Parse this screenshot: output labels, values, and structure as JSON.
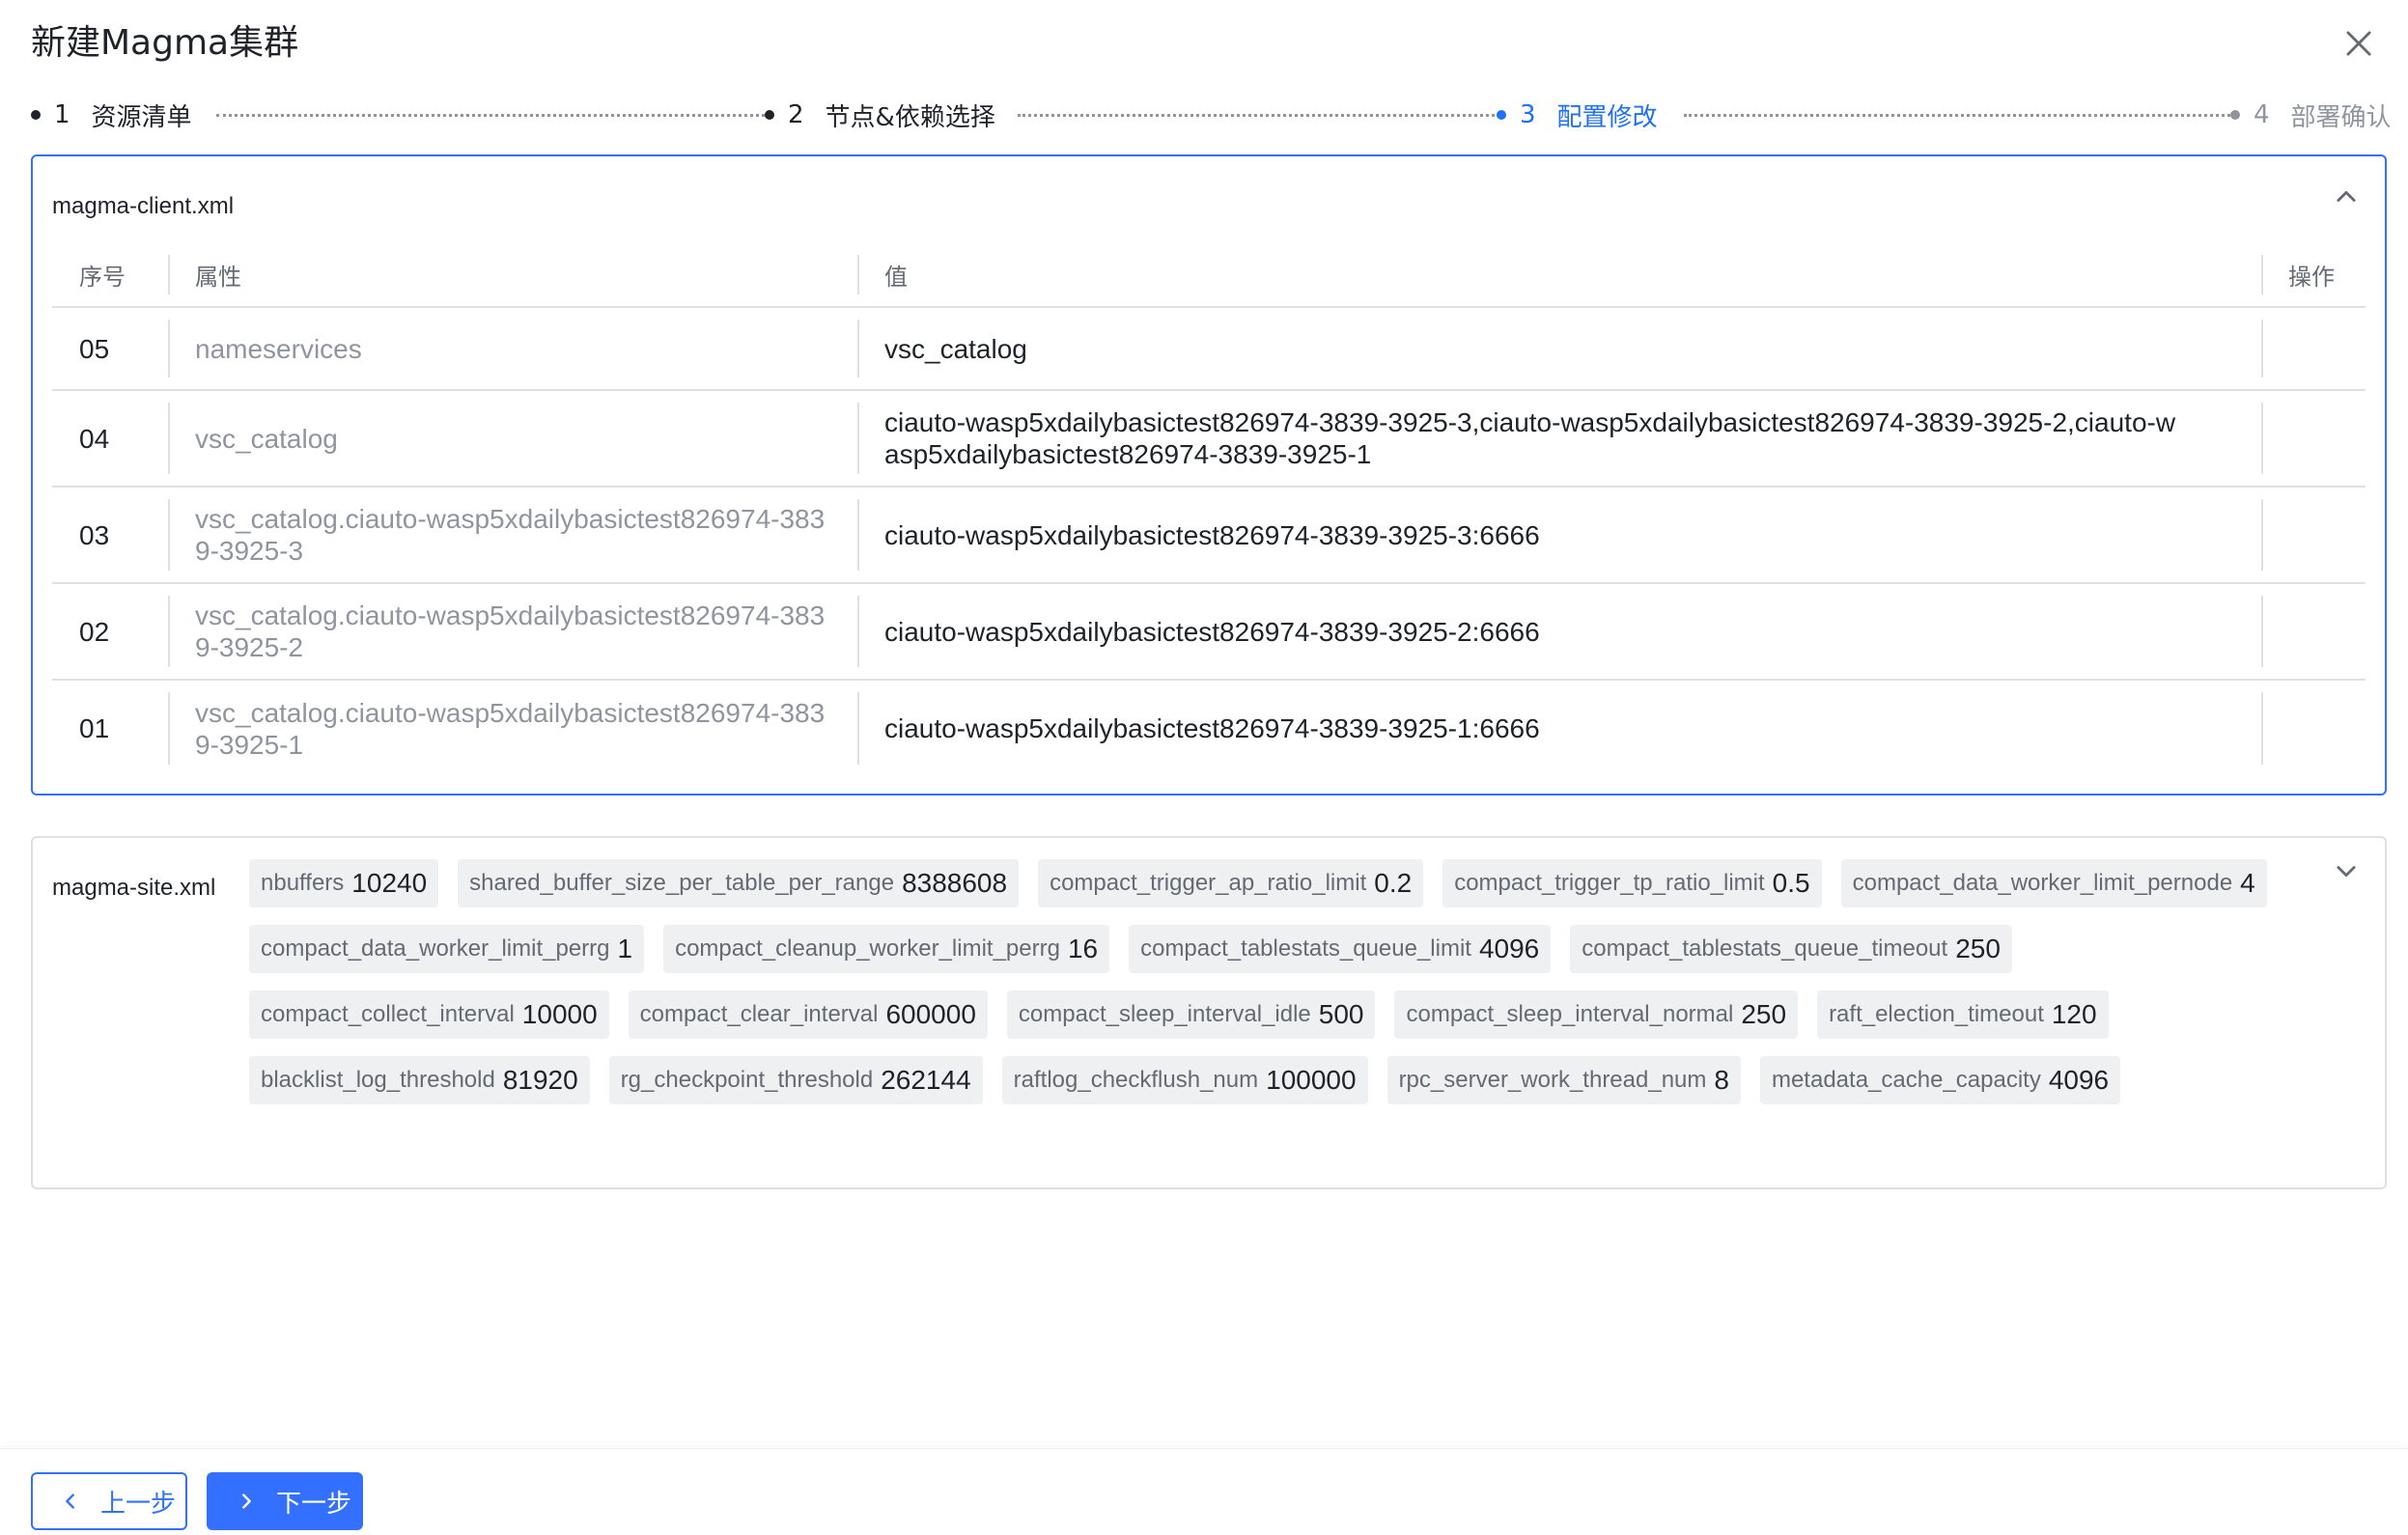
{
  "dialog": {
    "title": "新建Magma集群"
  },
  "steps": [
    {
      "num": "1",
      "label": "资源清单",
      "state": "done"
    },
    {
      "num": "2",
      "label": "节点&依赖选择",
      "state": "done"
    },
    {
      "num": "3",
      "label": "配置修改",
      "state": "active"
    },
    {
      "num": "4",
      "label": "部署确认",
      "state": "future"
    }
  ],
  "client_panel": {
    "title": "magma-client.xml",
    "columns": {
      "seq": "序号",
      "attr": "属性",
      "val": "值",
      "op": "操作"
    },
    "rows": [
      {
        "seq": "05",
        "attr": "nameservices",
        "val": "vsc_catalog"
      },
      {
        "seq": "04",
        "attr": "vsc_catalog",
        "val": "ciauto-wasp5xdailybasictest826974-3839-3925-3,ciauto-wasp5xdailybasictest826974-3839-3925-2,ciauto-wasp5xdailybasictest826974-3839-3925-1"
      },
      {
        "seq": "03",
        "attr": "vsc_catalog.ciauto-wasp5xdailybasictest826974-3839-3925-3",
        "val": "ciauto-wasp5xdailybasictest826974-3839-3925-3:6666"
      },
      {
        "seq": "02",
        "attr": "vsc_catalog.ciauto-wasp5xdailybasictest826974-3839-3925-2",
        "val": "ciauto-wasp5xdailybasictest826974-3839-3925-2:6666"
      },
      {
        "seq": "01",
        "attr": "vsc_catalog.ciauto-wasp5xdailybasictest826974-3839-3925-1",
        "val": "ciauto-wasp5xdailybasictest826974-3839-3925-1:6666"
      }
    ]
  },
  "site_panel": {
    "title": "magma-site.xml",
    "tags": [
      {
        "key": "nbuffers",
        "value": "10240"
      },
      {
        "key": "shared_buffer_size_per_table_per_range",
        "value": "8388608"
      },
      {
        "key": "compact_trigger_ap_ratio_limit",
        "value": "0.2"
      },
      {
        "key": "compact_trigger_tp_ratio_limit",
        "value": "0.5"
      },
      {
        "key": "compact_data_worker_limit_pernode",
        "value": "4"
      },
      {
        "key": "compact_data_worker_limit_perrg",
        "value": "1"
      },
      {
        "key": "compact_cleanup_worker_limit_perrg",
        "value": "16"
      },
      {
        "key": "compact_tablestats_queue_limit",
        "value": "4096"
      },
      {
        "key": "compact_tablestats_queue_timeout",
        "value": "250"
      },
      {
        "key": "compact_collect_interval",
        "value": "10000"
      },
      {
        "key": "compact_clear_interval",
        "value": "600000"
      },
      {
        "key": "compact_sleep_interval_idle",
        "value": "500"
      },
      {
        "key": "compact_sleep_interval_normal",
        "value": "250"
      },
      {
        "key": "raft_election_timeout",
        "value": "120"
      },
      {
        "key": "blacklist_log_threshold",
        "value": "81920"
      },
      {
        "key": "rg_checkpoint_threshold",
        "value": "262144"
      },
      {
        "key": "raftlog_checkflush_num",
        "value": "100000"
      },
      {
        "key": "rpc_server_work_thread_num",
        "value": "8"
      },
      {
        "key": "metadata_cache_capacity",
        "value": "4096"
      }
    ]
  },
  "footer": {
    "prev_label": "上一步",
    "next_label": "下一步"
  },
  "icons": {
    "close": "close-icon",
    "collapse": "chevron-up-icon",
    "expand": "chevron-down-icon",
    "prev": "chevron-left-icon",
    "next": "chevron-right-icon"
  },
  "colors": {
    "accent": "#3370ff",
    "text": "#1f2329",
    "muted": "#8f959e",
    "tag_bg": "#eff0f1"
  }
}
